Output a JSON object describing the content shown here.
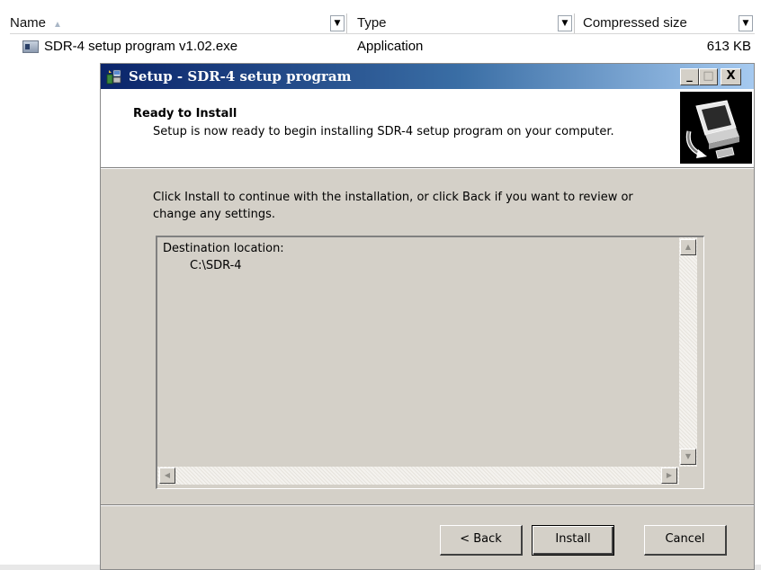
{
  "explorer": {
    "columns": {
      "name": "Name",
      "type": "Type",
      "compressed_size": "Compressed size"
    },
    "rows": [
      {
        "name": "SDR-4 setup program v1.02.exe",
        "type": "Application",
        "size": "613 KB"
      }
    ]
  },
  "dialog": {
    "title": "Setup - SDR-4 setup program",
    "window_buttons": {
      "minimize": "_",
      "maximize": "□",
      "close": "X"
    },
    "header": {
      "title": "Ready to Install",
      "subtitle": "Setup is now ready to begin installing SDR-4 setup program on your computer."
    },
    "intro_line1": "Click Install to continue with the installation, or click Back if you want to review or",
    "intro_line2": "change any settings.",
    "memo": {
      "label": "Destination location:",
      "value": "C:\\SDR-4"
    },
    "buttons": {
      "back": "< Back",
      "install": "Install",
      "cancel": "Cancel"
    }
  },
  "icons": {
    "file": "exe-file-icon",
    "title": "setup-installer-icon",
    "logo": "computer-install-logo"
  },
  "colors": {
    "titlebar_start": "#0a246a",
    "titlebar_end": "#a6caf0",
    "dialog_face": "#d4d0c8"
  }
}
